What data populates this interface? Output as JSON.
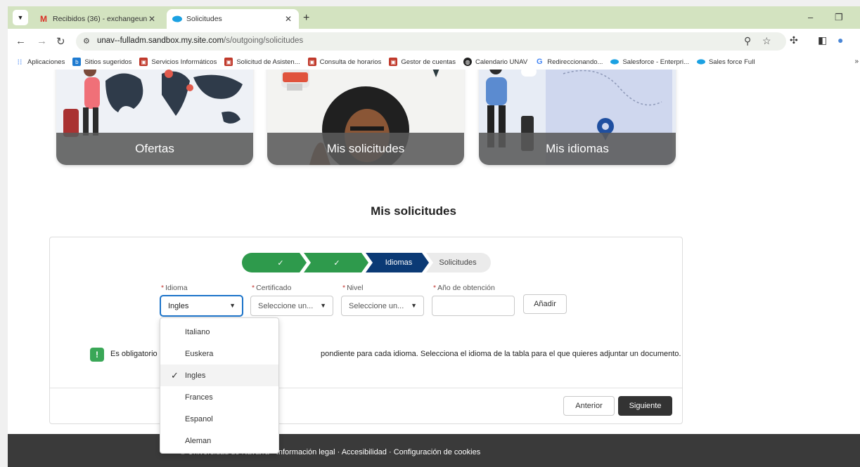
{
  "browser": {
    "tabs": [
      {
        "title": "Recibidos (36) - exchangeunav",
        "icon": "gmail-icon"
      },
      {
        "title": "Solicitudes",
        "icon": "salesforce-cloud-icon"
      }
    ],
    "url_host": "unav--fulladm.sandbox.my.site.com",
    "url_path": "/s/outgoing/solicitudes",
    "bookmarks": [
      {
        "label": "Aplicaciones",
        "color": "#4285f4"
      },
      {
        "label": "Sitios sugeridos",
        "color": "#1f7bd1"
      },
      {
        "label": "Servicios Informáticos",
        "color": "#c0392b"
      },
      {
        "label": "Solicitud de Asisten...",
        "color": "#c0392b"
      },
      {
        "label": "Consulta de horarios",
        "color": "#c0392b"
      },
      {
        "label": "Gestor de cuentas",
        "color": "#c0392b"
      },
      {
        "label": "Calendario UNAV",
        "color": "#222222"
      },
      {
        "label": "Redireccionando...",
        "color": "#4285f4"
      },
      {
        "label": "Salesforce - Enterpri...",
        "color": "#1ba1e2"
      },
      {
        "label": "Sales force Full",
        "color": "#1ba1e2"
      }
    ]
  },
  "cards": [
    {
      "label": "Ofertas"
    },
    {
      "label": "Mis solicitudes"
    },
    {
      "label": "Mis idiomas"
    }
  ],
  "section_title": "Mis solicitudes",
  "steps": {
    "current": "Idiomas",
    "next": "Solicitudes"
  },
  "form": {
    "idioma_label": "Idioma",
    "idioma_value": "Ingles",
    "certificado_label": "Certificado",
    "certificado_value": "Seleccione un...",
    "nivel_label": "Nivel",
    "nivel_value": "Seleccione un...",
    "anio_label": "Año de obtención",
    "anio_value": "",
    "add_button": "Añadir"
  },
  "info": {
    "prefix": "Es obligatorio",
    "suffix": "pondiente para cada idioma. Selecciona el idioma de la tabla para el que quieres adjuntar un documento."
  },
  "buttons": {
    "prev": "Anterior",
    "next": "Siguiente"
  },
  "dropdown": {
    "options": [
      "Italiano",
      "Euskera",
      "Ingles",
      "Frances",
      "Espanol",
      "Aleman"
    ],
    "selected": "Ingles"
  },
  "footer": {
    "copyright": "© Universidad de Navarra",
    "links": "Información legal · Accesibilidad · Configuración de cookies"
  },
  "colors": {
    "step_done": "#2e9a4c",
    "step_current": "#0b3a75",
    "tabstrip": "#d3e3c0"
  }
}
